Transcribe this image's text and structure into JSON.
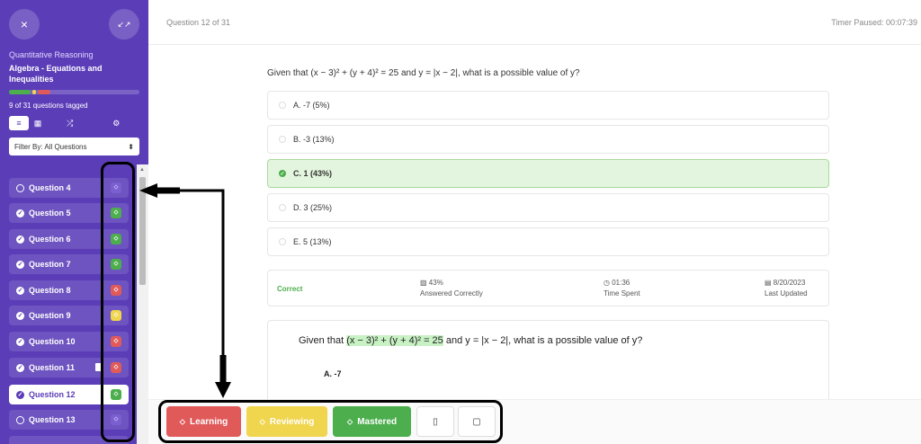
{
  "sidebar": {
    "close_icon": "×",
    "collapse_icon": "↙↗",
    "subject": "Quantitative Reasoning",
    "topic": "Algebra - Equations and Inequalities",
    "tagged_count": "9 of 31 questions tagged",
    "view_icons": [
      "≡",
      "▦",
      "⤮",
      "⚙"
    ],
    "filter": "Filter By: All Questions",
    "filter_caret": "⬍",
    "questions": [
      {
        "label": "Question 4",
        "status": "empty",
        "tag": "none"
      },
      {
        "label": "Question 5",
        "status": "done",
        "tag": "green"
      },
      {
        "label": "Question 6",
        "status": "done",
        "tag": "green"
      },
      {
        "label": "Question 7",
        "status": "done",
        "tag": "green"
      },
      {
        "label": "Question 8",
        "status": "done",
        "tag": "red"
      },
      {
        "label": "Question 9",
        "status": "done",
        "tag": "yellow"
      },
      {
        "label": "Question 10",
        "status": "done",
        "tag": "red"
      },
      {
        "label": "Question 11",
        "status": "done",
        "tag": "red"
      },
      {
        "label": "Question 12",
        "status": "done",
        "tag": "green"
      },
      {
        "label": "Question 13",
        "status": "empty",
        "tag": "none"
      }
    ]
  },
  "header": {
    "question_count": "Question 12 of 31",
    "timer": "Timer Paused: 00:07:39"
  },
  "question": "Given that (x − 3)² + (y + 4)² = 25 and y = |x − 2|, what is a possible value of y?",
  "options": [
    {
      "label": "A. -7",
      "pct": "(5%)"
    },
    {
      "label": "B. -3",
      "pct": "(13%)"
    },
    {
      "label": "C. 1",
      "pct": "(43%)"
    },
    {
      "label": "D. 3",
      "pct": "(25%)"
    },
    {
      "label": "E. 5",
      "pct": "(13%)"
    }
  ],
  "stats": {
    "status": "Correct",
    "answered_value": "43%",
    "answered_label": "Answered Correctly",
    "time_value": "01:36",
    "time_label": "Time Spent",
    "updated_value": "8/20/2023",
    "updated_label": "Last Updated"
  },
  "explanation": {
    "prefix": "Given that ",
    "highlight": "(x − 3)² + (y + 4)² = 25",
    "suffix": " and y = |x − 2|, what is a possible value of y?",
    "option_a": "A. -7"
  },
  "toolbar": {
    "learning": "Learning",
    "reviewing": "Reviewing",
    "mastered": "Mastered"
  },
  "colors": {
    "sidebar": "#5b3db8",
    "learning": "#e05a5a",
    "reviewing": "#f0d54e",
    "mastered": "#4cae4c"
  }
}
